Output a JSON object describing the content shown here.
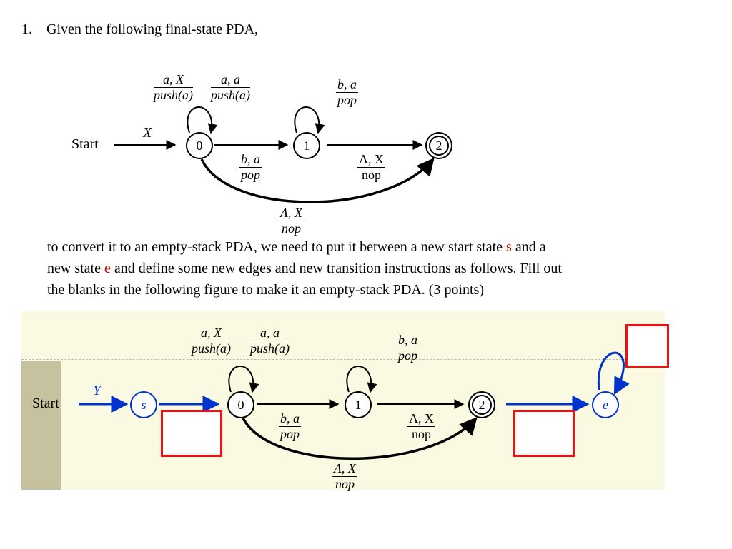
{
  "question": {
    "number": "1.",
    "prompt": "Given the following final-state PDA,"
  },
  "pda1": {
    "start_label": "Start",
    "stack_init": "X",
    "states": {
      "q0": "0",
      "q1": "1",
      "q2": "2"
    },
    "edges": {
      "loop0_left": {
        "top": "a, X",
        "bot": "push(a)"
      },
      "loop0_right": {
        "top": "a, a",
        "bot": "push(a)"
      },
      "e01": {
        "top": "b, a",
        "bot": "pop"
      },
      "loop1": {
        "top": "b, a",
        "bot": "pop"
      },
      "e12": {
        "top": "Λ, X",
        "bot": "nop"
      },
      "e02": {
        "top": "Λ, X",
        "bot": "nop"
      }
    }
  },
  "middle_text": {
    "l1a": "to convert it to an empty-stack PDA, we need to put it between a new start state ",
    "s": "s",
    "l1b": " and a",
    "l2a": "new state ",
    "e": "e",
    "l2b": " and define some new edges and new transition instructions as follows. Fill out",
    "l3": "the blanks in the following figure to make it an empty-stack PDA.   (3 points)"
  },
  "pda2": {
    "start_label": "Start",
    "stack_init": "Y",
    "states": {
      "s": "s",
      "q0": "0",
      "q1": "1",
      "q2": "2",
      "e": "e"
    },
    "edges": {
      "loop0_left": {
        "top": "a, X",
        "bot": "push(a)"
      },
      "loop0_right": {
        "top": "a, a",
        "bot": "push(a)"
      },
      "e01": {
        "top": "b, a",
        "bot": "pop"
      },
      "loop1": {
        "top": "b, a",
        "bot": "pop"
      },
      "e12": {
        "top": "Λ, X",
        "bot": "nop"
      },
      "e02": {
        "top": "Λ, X",
        "bot": "nop"
      }
    }
  },
  "chart_data": {
    "type": "diagram",
    "note": "Two pushdown-automaton state diagrams; states and transition labels captured in pda1/pda2 above. Red boxes in pda2 are blanks to be filled."
  }
}
